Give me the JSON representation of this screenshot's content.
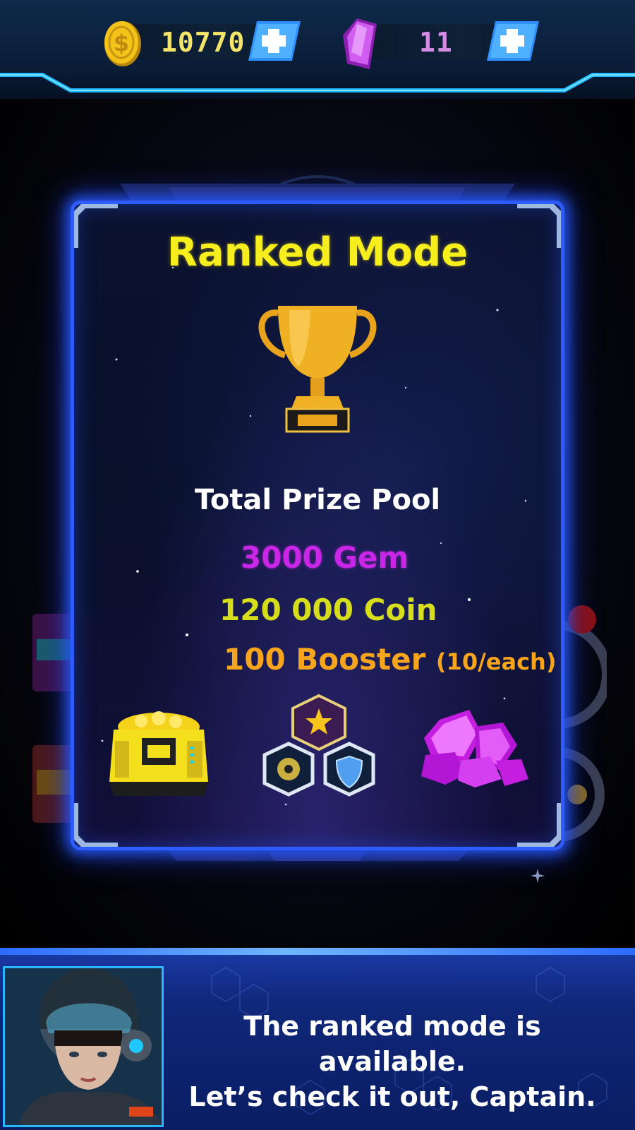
{
  "currency": {
    "coins": "10770",
    "gems": "11"
  },
  "modal": {
    "title": "Ranked Mode",
    "pool_label": "Total Prize Pool",
    "prizes": {
      "gem": "3000 Gem",
      "coin": "120 000 Coin",
      "booster": "100 Booster",
      "booster_note": "(10/each)"
    },
    "rewards": [
      "coin-chest-icon",
      "booster-pack-icon",
      "gem-pile-icon"
    ]
  },
  "dialogue": {
    "line1": "The ranked mode is available.",
    "line2": "Let’s check it out, Captain."
  },
  "colors": {
    "title": "#f7ef1d",
    "gem_text": "#c926e8",
    "coin_text": "#d6dd1b",
    "booster_text": "#f7a51c",
    "modal_border": "#2e5cff"
  }
}
